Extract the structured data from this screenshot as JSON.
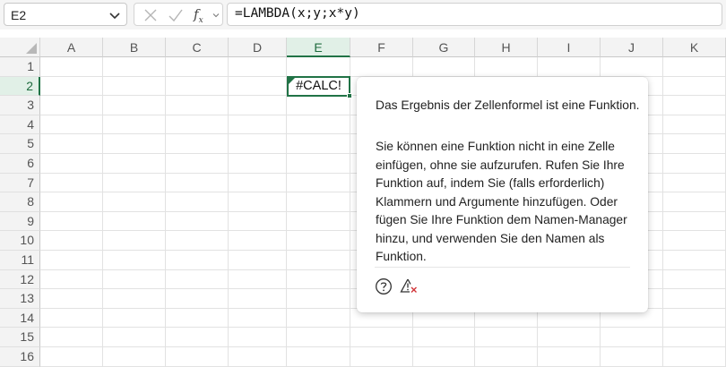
{
  "formula_bar": {
    "name_box": "E2",
    "formula": "=LAMBDA(x;y;x*y)",
    "fx_label": "f",
    "fx_sub": "x"
  },
  "grid": {
    "columns": [
      "A",
      "B",
      "C",
      "D",
      "E",
      "F",
      "G",
      "H",
      "I",
      "J",
      "K"
    ],
    "rows": [
      "1",
      "2",
      "3",
      "4",
      "5",
      "6",
      "7",
      "8",
      "9",
      "10",
      "11",
      "12",
      "13",
      "14",
      "15",
      "16"
    ],
    "selected_column": "E",
    "selected_row": "2",
    "active_cell_value": "#CALC!"
  },
  "callout": {
    "paragraph1": "Das Ergebnis der Zellenformel ist eine Funktion.",
    "paragraph2": "Sie können eine Funktion nicht in eine Zelle einfügen, ohne sie aufzurufen. Rufen Sie Ihre Funktion auf, indem Sie (falls erforderlich) Klammern und Argumente hinzufügen. Oder fügen Sie Ihre Funktion dem Namen-Manager hinzu, und verwenden Sie den Namen als Funktion.",
    "icons": [
      "help-icon",
      "ignore-error-icon"
    ]
  },
  "colors": {
    "accent_green": "#217346",
    "header_bg": "#f3f3f3",
    "selected_header_bg": "#e1f0e7"
  }
}
